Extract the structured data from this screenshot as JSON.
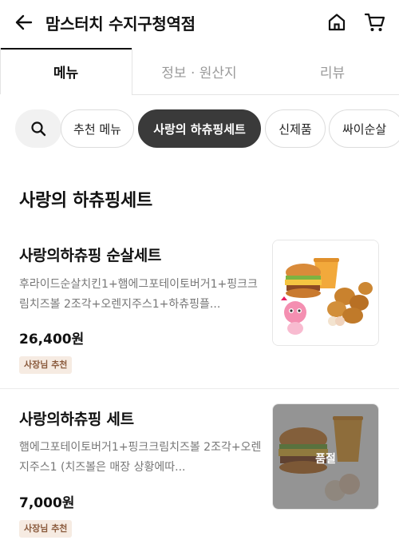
{
  "header": {
    "title": "맘스터치 수지구청역점",
    "icons": [
      "back-arrow-icon",
      "home-icon",
      "cart-icon"
    ]
  },
  "tabs": [
    {
      "label": "메뉴",
      "active": true
    },
    {
      "label": "정보 · 원산지",
      "active": false
    },
    {
      "label": "리뷰",
      "active": false
    }
  ],
  "chips": [
    {
      "label": "추천 메뉴",
      "active": false
    },
    {
      "label": "사랑의 하츄핑세트",
      "active": true
    },
    {
      "label": "신제품",
      "active": false
    },
    {
      "label": "싸이순살",
      "active": false
    }
  ],
  "section": {
    "title": "사랑의 하츄핑세트"
  },
  "items": [
    {
      "name": "사랑의하츄핑 순살세트",
      "desc": "후라이드순살치킨1+햄에그포테이토버거1+핑크크림치즈볼 2조각+오렌지주스1+하츄핑플...",
      "price": "26,400원",
      "badge": "사장님 추천",
      "sold_out": false
    },
    {
      "name": "사랑의하츄핑 세트",
      "desc": "햄에그포테이토버거1+핑크크림치즈볼 2조각+오렌지주스1 (치즈볼은 매장 상황에따...",
      "price": "7,000원",
      "badge": "사장님 추천",
      "sold_out": true,
      "sold_out_label": "품절"
    }
  ],
  "colors": {
    "active_chip": "#3a3a3a",
    "badge_bg": "#f6ebe2",
    "badge_text": "#8a5a3c"
  }
}
